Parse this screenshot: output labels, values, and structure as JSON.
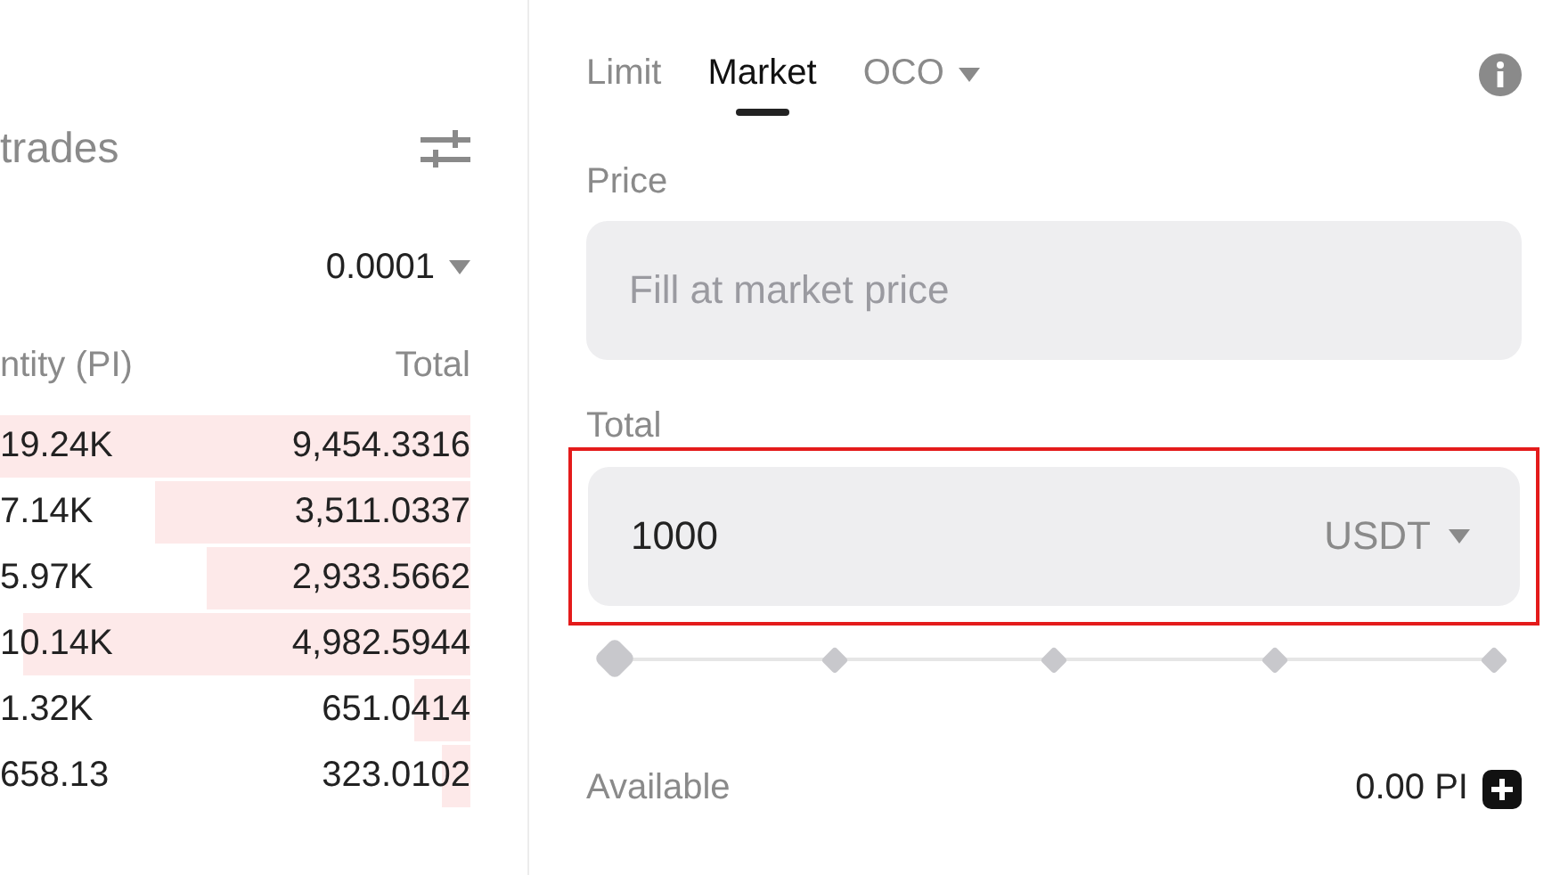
{
  "order_book": {
    "title": "trades",
    "precision": "0.0001",
    "columns": [
      "ntity (PI)",
      "Total"
    ],
    "rows": [
      {
        "quantity": "19.24K",
        "total": "9,454.3316"
      },
      {
        "quantity": "7.14K",
        "total": "3,511.0337"
      },
      {
        "quantity": "5.97K",
        "total": "2,933.5662"
      },
      {
        "quantity": "10.14K",
        "total": "4,982.5944"
      },
      {
        "quantity": "1.32K",
        "total": "651.0414"
      },
      {
        "quantity": "658.13",
        "total": "323.0102"
      }
    ]
  },
  "order_form": {
    "tabs": [
      {
        "label": "Limit",
        "selected": false,
        "dropdown": false
      },
      {
        "label": "Market",
        "selected": true,
        "dropdown": false
      },
      {
        "label": "OCO",
        "selected": false,
        "dropdown": true
      }
    ],
    "price": {
      "label": "Price",
      "placeholder": "Fill at market price"
    },
    "total": {
      "label": "Total",
      "value": "1000",
      "currency": "USDT",
      "highlighted": true
    },
    "slider": {
      "level": 0
    },
    "available": {
      "label": "Available",
      "value": "0.00 PI"
    }
  }
}
